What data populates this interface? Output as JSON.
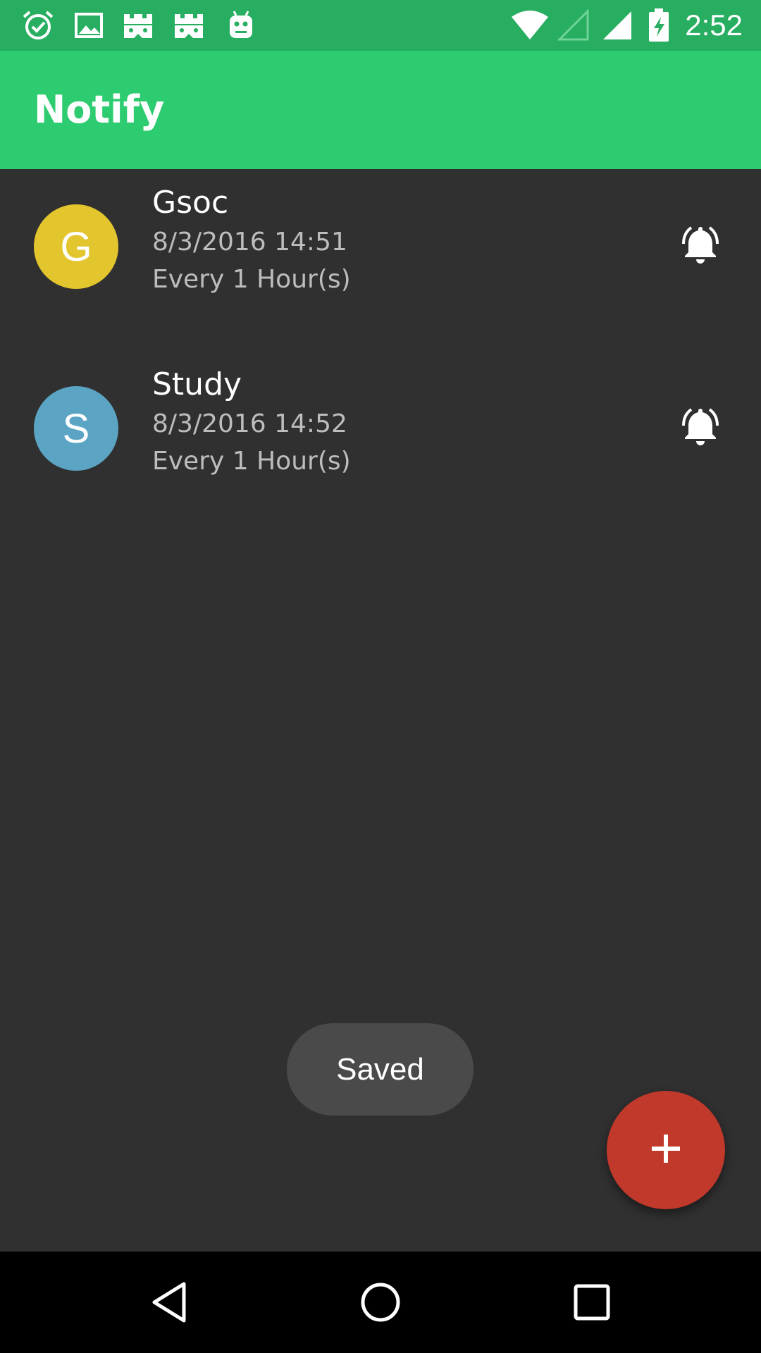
{
  "status_bar": {
    "time": "2:52",
    "left_icons": [
      "alarm-check-icon",
      "image-icon",
      "game-icon",
      "game-icon",
      "android-icon"
    ],
    "right_icons": [
      "wifi-icon",
      "signal-empty-icon",
      "signal-full-icon",
      "battery-charging-icon"
    ]
  },
  "app_bar": {
    "title": "Notify"
  },
  "reminders": [
    {
      "initial": "G",
      "avatar_color": "#E3C52E",
      "title": "Gsoc",
      "datetime": "8/3/2016 14:51",
      "repeat": "Every 1 Hour(s)",
      "icon": "bell-ringing-icon"
    },
    {
      "initial": "S",
      "avatar_color": "#5BA4C4",
      "title": "Study",
      "datetime": "8/3/2016 14:52",
      "repeat": "Every 1 Hour(s)",
      "icon": "bell-ringing-icon"
    }
  ],
  "toast": {
    "text": "Saved"
  },
  "fab": {
    "icon": "plus-icon",
    "color": "#C0392B"
  },
  "colors": {
    "status_bar": "#27AE60",
    "app_bar": "#2ECC71",
    "background": "#303030"
  },
  "nav_bar": {
    "buttons": [
      "back-icon",
      "home-icon",
      "recents-icon"
    ]
  }
}
